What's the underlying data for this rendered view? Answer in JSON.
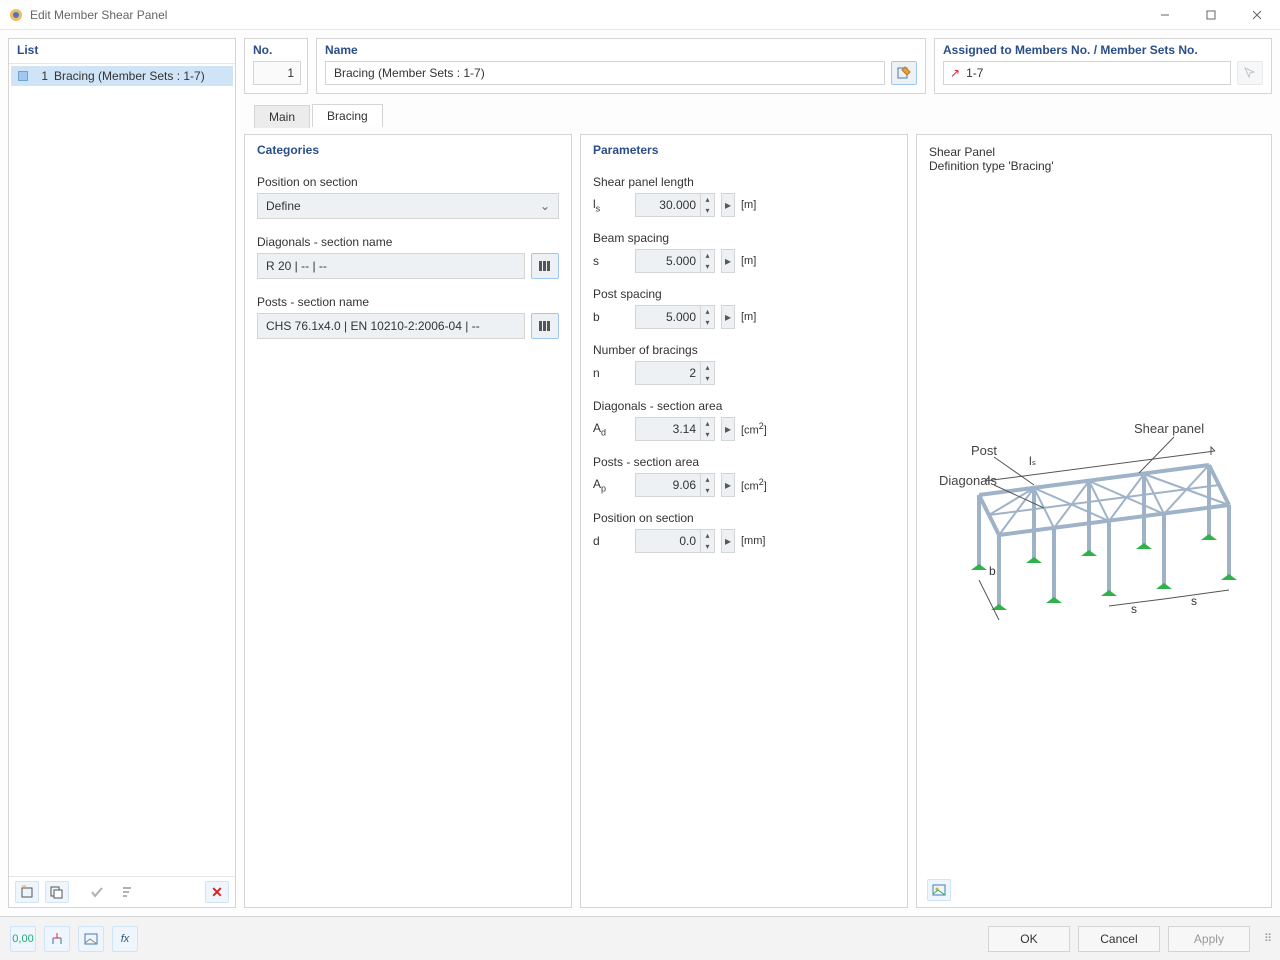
{
  "window": {
    "title": "Edit Member Shear Panel"
  },
  "left": {
    "heading": "List",
    "items": [
      {
        "index": "1",
        "label": "Bracing (Member Sets : 1-7)"
      }
    ],
    "toolbar_icons": [
      "new-icon",
      "copy-icon",
      "check-icon",
      "sort-icon"
    ],
    "delete_label": "✕"
  },
  "top": {
    "no_label": "No.",
    "no_value": "1",
    "name_label": "Name",
    "name_value": "Bracing (Member Sets : 1-7)",
    "assign_label": "Assigned to Members No. / Member Sets No.",
    "assign_value": "1-7"
  },
  "tabs": {
    "main": "Main",
    "bracing": "Bracing",
    "active": "bracing"
  },
  "categories": {
    "title": "Categories",
    "position_label": "Position on section",
    "position_value": "Define",
    "diagonals_label": "Diagonals - section name",
    "diagonals_value": "R 20 | -- | --",
    "posts_label": "Posts - section name",
    "posts_value": "CHS 76.1x4.0 | EN 10210-2:2006-04 | --"
  },
  "parameters": {
    "title": "Parameters",
    "rows": [
      {
        "key": "len",
        "label": "Shear panel length",
        "symbol_html": "l<span class='sub'>s</span>",
        "value": "30.000",
        "unit": "[m]"
      },
      {
        "key": "beam",
        "label": "Beam spacing",
        "symbol_html": "s",
        "value": "5.000",
        "unit": "[m]"
      },
      {
        "key": "post",
        "label": "Post spacing",
        "symbol_html": "b",
        "value": "5.000",
        "unit": "[m]"
      },
      {
        "key": "nbr",
        "label": "Number of bracings",
        "symbol_html": "n",
        "value": "2",
        "unit": "",
        "no_arrow": true
      },
      {
        "key": "ad",
        "label": "Diagonals - section area",
        "symbol_html": "A<span class='sub'>d</span>",
        "value": "3.14",
        "unit": "[cm<sup>2</sup>]"
      },
      {
        "key": "ap",
        "label": "Posts - section area",
        "symbol_html": "A<span class='sub'>p</span>",
        "value": "9.06",
        "unit": "[cm<sup>2</sup>]"
      },
      {
        "key": "d",
        "label": "Position on section",
        "symbol_html": "d",
        "value": "0.0",
        "unit": "[mm]"
      }
    ]
  },
  "description": {
    "title": "Shear Panel",
    "subtitle": "Definition type 'Bracing'",
    "diagram_labels": {
      "shear_panel": "Shear panel",
      "post": "Post",
      "diagonals": "Diagonals",
      "ls": "lₛ",
      "s": "s",
      "b": "b"
    }
  },
  "footer": {
    "small_icons": [
      "units-icon",
      "tree-icon",
      "png-icon",
      "fx-icon"
    ],
    "ok": "OK",
    "cancel": "Cancel",
    "apply": "Apply"
  }
}
